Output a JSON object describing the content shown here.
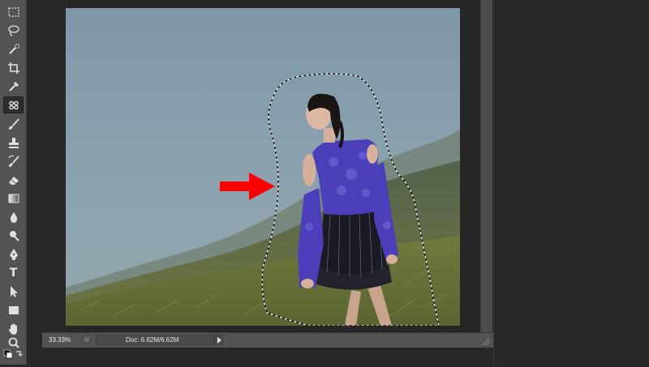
{
  "tools": [
    {
      "name": "rectangular-marquee-icon"
    },
    {
      "name": "lasso-icon"
    },
    {
      "name": "quick-selection-icon"
    },
    {
      "name": "crop-icon"
    },
    {
      "name": "eyedropper-icon"
    },
    {
      "name": "healing-brush-icon",
      "active": true
    },
    {
      "name": "brush-icon"
    },
    {
      "name": "clone-stamp-icon"
    },
    {
      "name": "history-brush-icon"
    },
    {
      "name": "eraser-icon"
    },
    {
      "name": "gradient-icon"
    },
    {
      "name": "blur-icon"
    },
    {
      "name": "dodge-icon"
    },
    {
      "name": "pen-icon"
    },
    {
      "name": "type-icon",
      "label": "T"
    },
    {
      "name": "path-selection-icon"
    },
    {
      "name": "rectangle-shape-icon"
    },
    {
      "name": "hand-icon"
    },
    {
      "name": "zoom-icon"
    }
  ],
  "status": {
    "zoom": "33.33%",
    "doc_size": "Doc: 6.62M/6.62M"
  },
  "colors": {
    "annotation_arrow": "#ff0000",
    "outfit": "#4a3fb8"
  }
}
